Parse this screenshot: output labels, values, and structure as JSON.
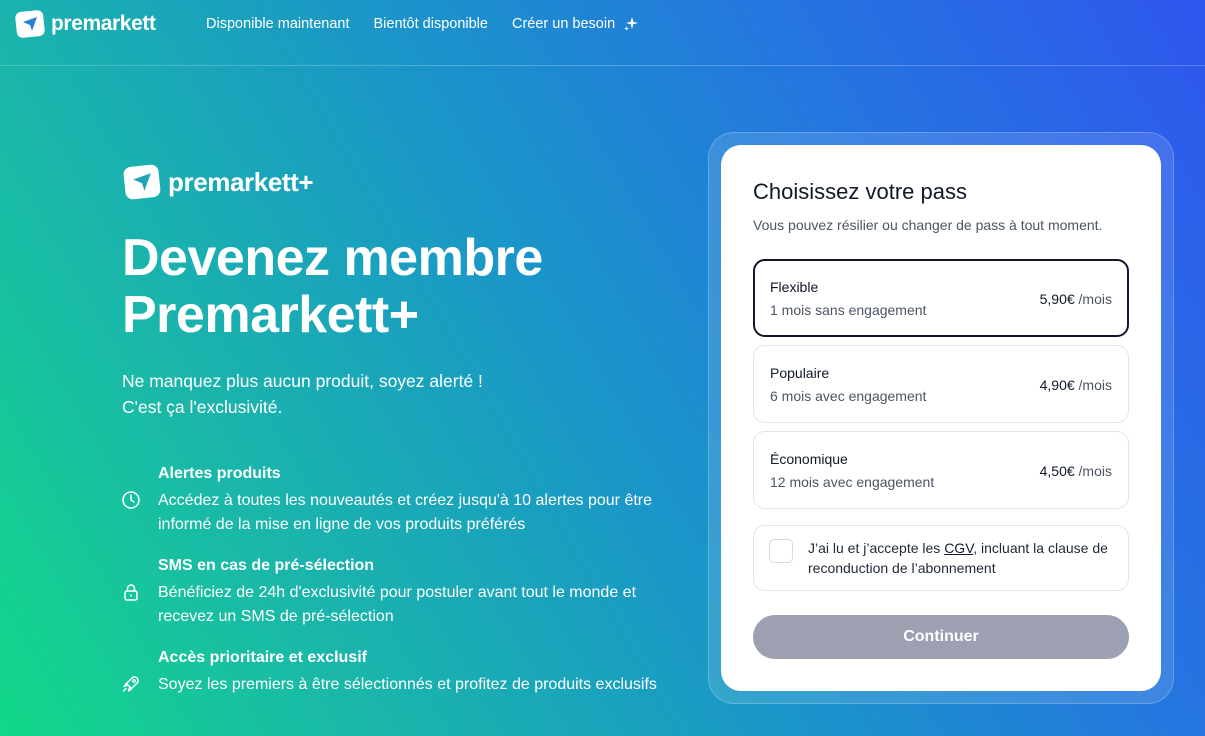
{
  "header": {
    "brand": "premarkett",
    "nav": [
      {
        "label": "Disponible maintenant"
      },
      {
        "label": "Bientôt disponible"
      },
      {
        "label": "Créer un besoin",
        "icon": "sparkle-icon"
      }
    ]
  },
  "hero": {
    "logo_text": "premarkett+",
    "title_line1": "Devenez membre",
    "title_line2": "Premarkett+",
    "subtitle_line1": "Ne manquez plus aucun produit, soyez alerté !",
    "subtitle_line2": "C'est ça l'exclusivité.",
    "features": [
      {
        "icon": "clock-icon",
        "title": "Alertes produits",
        "description": "Accédez à toutes les nouveautés et créez jusqu'à 10 alertes pour être informé de la mise en ligne de vos produits préférés"
      },
      {
        "icon": "lock-icon",
        "title": "SMS en cas de pré-sélection",
        "description": "Bénéficiez de 24h d'exclusivité pour postuler avant tout le monde et recevez un SMS de pré-sélection"
      },
      {
        "icon": "rocket-icon",
        "title": "Accès prioritaire et exclusif",
        "description": "Soyez les premiers à être sélectionnés et profitez de produits exclusifs"
      }
    ]
  },
  "pass_card": {
    "title": "Choisissez votre pass",
    "subtitle": "Vous pouvez résilier ou changer de pass à tout moment.",
    "plans": [
      {
        "name": "Flexible",
        "term": "1 mois sans engagement",
        "price": "5,90€",
        "unit": "/mois",
        "selected": true
      },
      {
        "name": "Populaire",
        "term": "6 mois avec engagement",
        "price": "4,90€",
        "unit": "/mois",
        "selected": false
      },
      {
        "name": "Économique",
        "term": "12 mois avec engagement",
        "price": "4,50€",
        "unit": "/mois",
        "selected": false
      }
    ],
    "terms_before": "J’ai lu et j’accepte les ",
    "terms_link": "CGV",
    "terms_after": ", incluant la clause de reconduction de l’abonnement",
    "terms_checked": false,
    "continue_label": "Continuer"
  },
  "colors": {
    "gradient_start": "#12d889",
    "gradient_end": "#2f56ee",
    "selected_border": "#12172b",
    "button_disabled": "#9ca0b0"
  }
}
